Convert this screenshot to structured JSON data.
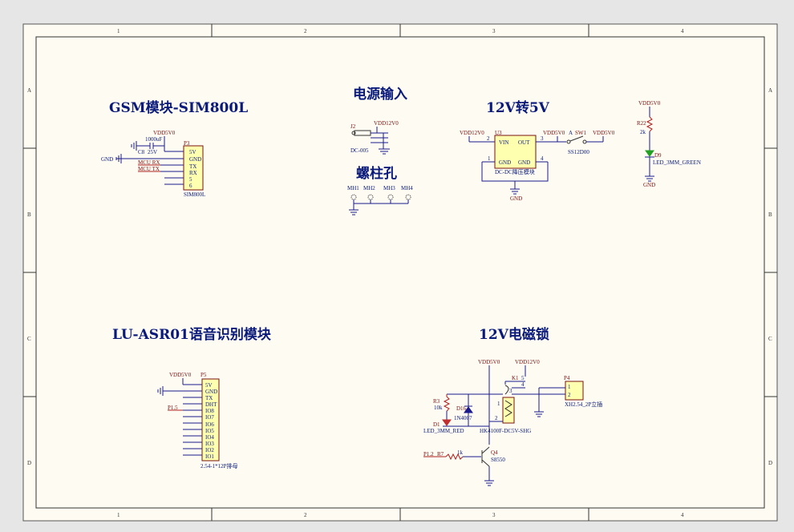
{
  "zones": {
    "columns": [
      "1",
      "2",
      "3",
      "4"
    ],
    "rows": [
      "A",
      "B",
      "C",
      "D"
    ]
  },
  "titles": {
    "gsm": "GSM模块-SIM800L",
    "power_in": "电源输入",
    "mount_holes": "螺柱孔",
    "buck": "12V转5V",
    "voice": "LU-ASR01语音识别模块",
    "lock": "12V电磁锁"
  },
  "gsm": {
    "vdd": "VDD5V0",
    "cap_value": "1000uF",
    "cap_ref": "C8",
    "cap_voltage": "25V",
    "gnd": "GND",
    "net_rx": "MCU RX",
    "net_tx": "MCU TX",
    "ref": "P3",
    "pins": [
      "5V",
      "GND",
      "TX",
      "RX",
      "5",
      "6"
    ],
    "footer": "SIM800L"
  },
  "power_in": {
    "ref": "J2",
    "vdd": "VDD12V0",
    "part": "DC-005"
  },
  "holes": [
    "MH1",
    "MH2",
    "MH3",
    "MH4"
  ],
  "buck": {
    "vin_net": "VDD12V0",
    "ref": "U3",
    "pin_vin": "VIN",
    "pin_out": "OUT",
    "pin_gnd1": "GND",
    "pin_gnd2": "GND",
    "pin2": "2",
    "pin3": "3",
    "pin1": "1",
    "pin4": "4",
    "part": "DC-DC降压模块",
    "gnd": "GND",
    "out_net": "VDD5V0",
    "sw_net_a": "A",
    "sw_ref": "SW1",
    "sw_part": "SS12D00",
    "sw_out_net": "VDD5V0"
  },
  "led_green": {
    "vdd": "VDD5V0",
    "r_ref": "R22",
    "r_val": "2k",
    "d_ref": "D9",
    "d_part": "LED_3MM_GREEN",
    "gnd": "GND"
  },
  "voice": {
    "vdd": "VDD5V0",
    "ref": "P5",
    "net": "P1.5",
    "pins": [
      "5V",
      "GND",
      "TX",
      "DHT",
      "IO8",
      "IO7",
      "IO6",
      "IO5",
      "IO4",
      "IO3",
      "IO2",
      "IO1"
    ],
    "footer": "2.54-1*12P排母"
  },
  "lock": {
    "vdd5": "VDD5V0",
    "vdd12": "VDD12V0",
    "relay_ref": "K1",
    "relay_pins": [
      "5",
      "4",
      "3",
      "1",
      "2"
    ],
    "relay_part": "HK4100F-DC5V-SHG",
    "r3_ref": "R3",
    "r3_val": "10k",
    "d16_ref": "D16",
    "d16_part": "1N4007",
    "d1_ref": "D1",
    "d1_part": "LED_3MM_RED",
    "conn_ref": "P4",
    "conn_pins": [
      "1",
      "2"
    ],
    "conn_part": "XH2.54_2P立插",
    "base_net": "P1.2",
    "r7_ref": "R7",
    "r7_val": "1k",
    "q_ref": "Q4",
    "q_part": "S8550"
  }
}
